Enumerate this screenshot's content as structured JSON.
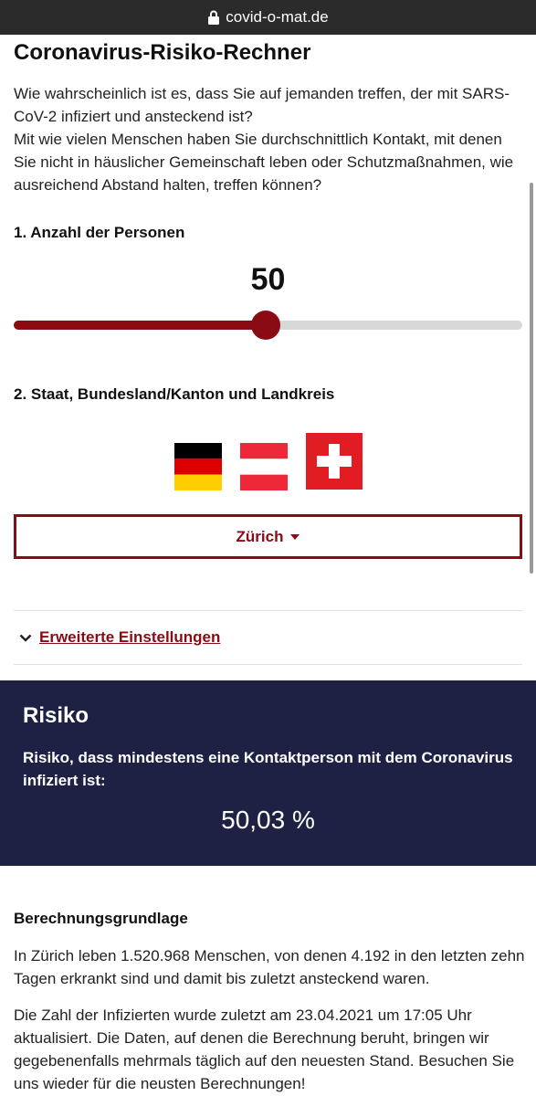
{
  "browser": {
    "url": "covid-o-mat.de"
  },
  "page": {
    "title": "Coronavirus-Risiko-Rechner",
    "intro": [
      "Wie wahrscheinlich ist es, dass Sie auf jemanden treffen, der mit SARS-CoV-2 infiziert und ansteckend ist?",
      "Mit wie vielen Menschen haben Sie durchschnittlich Kontakt, mit denen Sie nicht in häuslicher Gemeinschaft leben oder Schutzmaßnahmen, wie ausreichend Abstand halten, treffen können?"
    ]
  },
  "persons": {
    "label": "1. Anzahl der Personen",
    "value": "50",
    "slider_fraction": 0.496
  },
  "region": {
    "label": "2. Staat, Bundesland/Kanton und Landkreis",
    "flags": [
      "germany-flag",
      "austria-flag",
      "switzerland-flag"
    ],
    "selected": "Zürich"
  },
  "advanced": {
    "label": "Erweiterte Einstellungen"
  },
  "risk": {
    "title": "Risiko",
    "description": "Risiko, dass mindestens eine Kontaktperson mit dem Coronavirus infiziert ist:",
    "value": "50,03 %"
  },
  "basis": {
    "title": "Berechnungsgrundlage",
    "text1": "In Zürich leben 1.520.968 Menschen, von denen 4.192 in den letzten zehn Tagen erkrankt sind und damit bis zuletzt ansteckend waren.",
    "text2": "Die Zahl der Infizierten wurde zuletzt am 23.04.2021 um 17:05 Uhr aktualisiert. Die Daten, auf denen die Berechnung beruht, bringen wir gegebenenfalls mehrmals täglich auf den neuesten Stand. Besuchen Sie uns wieder für die neusten Berechnungen!"
  },
  "colors": {
    "accent": "#8b0b14",
    "risk_panel": "#1e2144",
    "browser_bar": "#2b2b2b"
  }
}
